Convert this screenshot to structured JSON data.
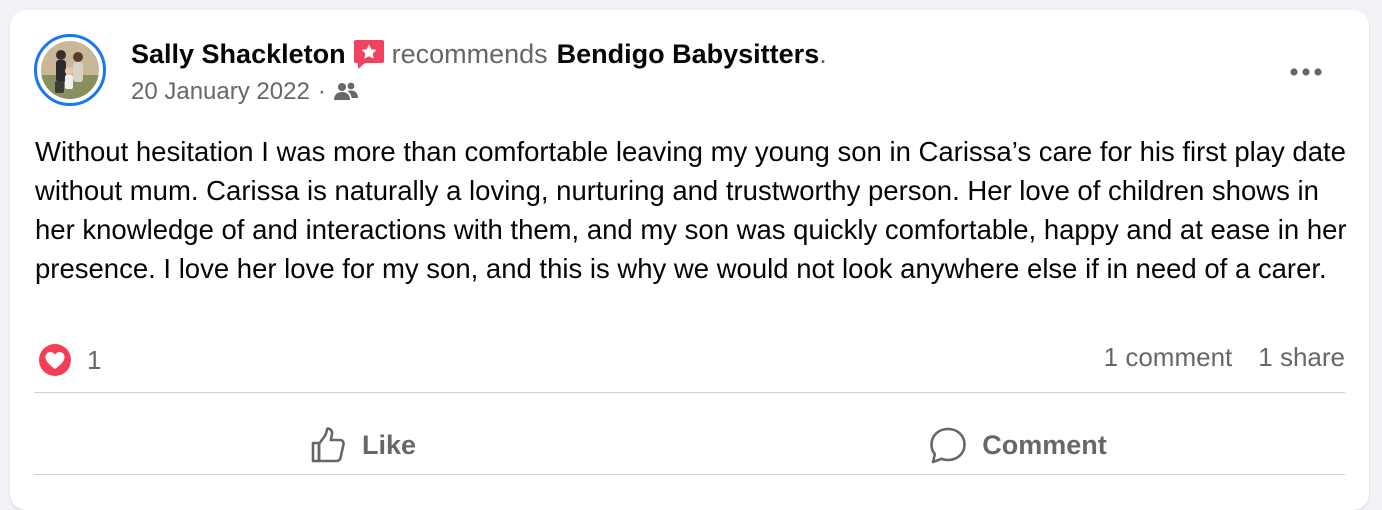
{
  "post": {
    "author": "Sally Shackleton",
    "verb": "recommends",
    "page_name": "Bendigo Babysitters",
    "period": ".",
    "date": "20 January 2022",
    "separator": "·",
    "audience_icon": "friends-icon",
    "recommend_icon": "recommendation-flag-icon",
    "body": "Without hesitation I was more than comfortable leaving my young son in Carissa’s care for his first play date without mum. Carissa is naturally a loving, nurturing and trustworthy person. Her love of children shows in her knowledge of and interactions with them, and my son was quickly comfortable, happy and at ease in her presence. I love her love for my son, and this is why we would not look anywhere else if in need of a carer."
  },
  "engagement": {
    "reaction_icon": "love-reaction-icon",
    "reaction_count": "1",
    "comments": "1 comment",
    "shares": "1 share"
  },
  "actions": {
    "like_label": "Like",
    "comment_label": "Comment"
  },
  "colors": {
    "accent": "#1877f2",
    "love": "#f33e58",
    "recommend": "#f3425f",
    "secondary_text": "#65676b"
  }
}
